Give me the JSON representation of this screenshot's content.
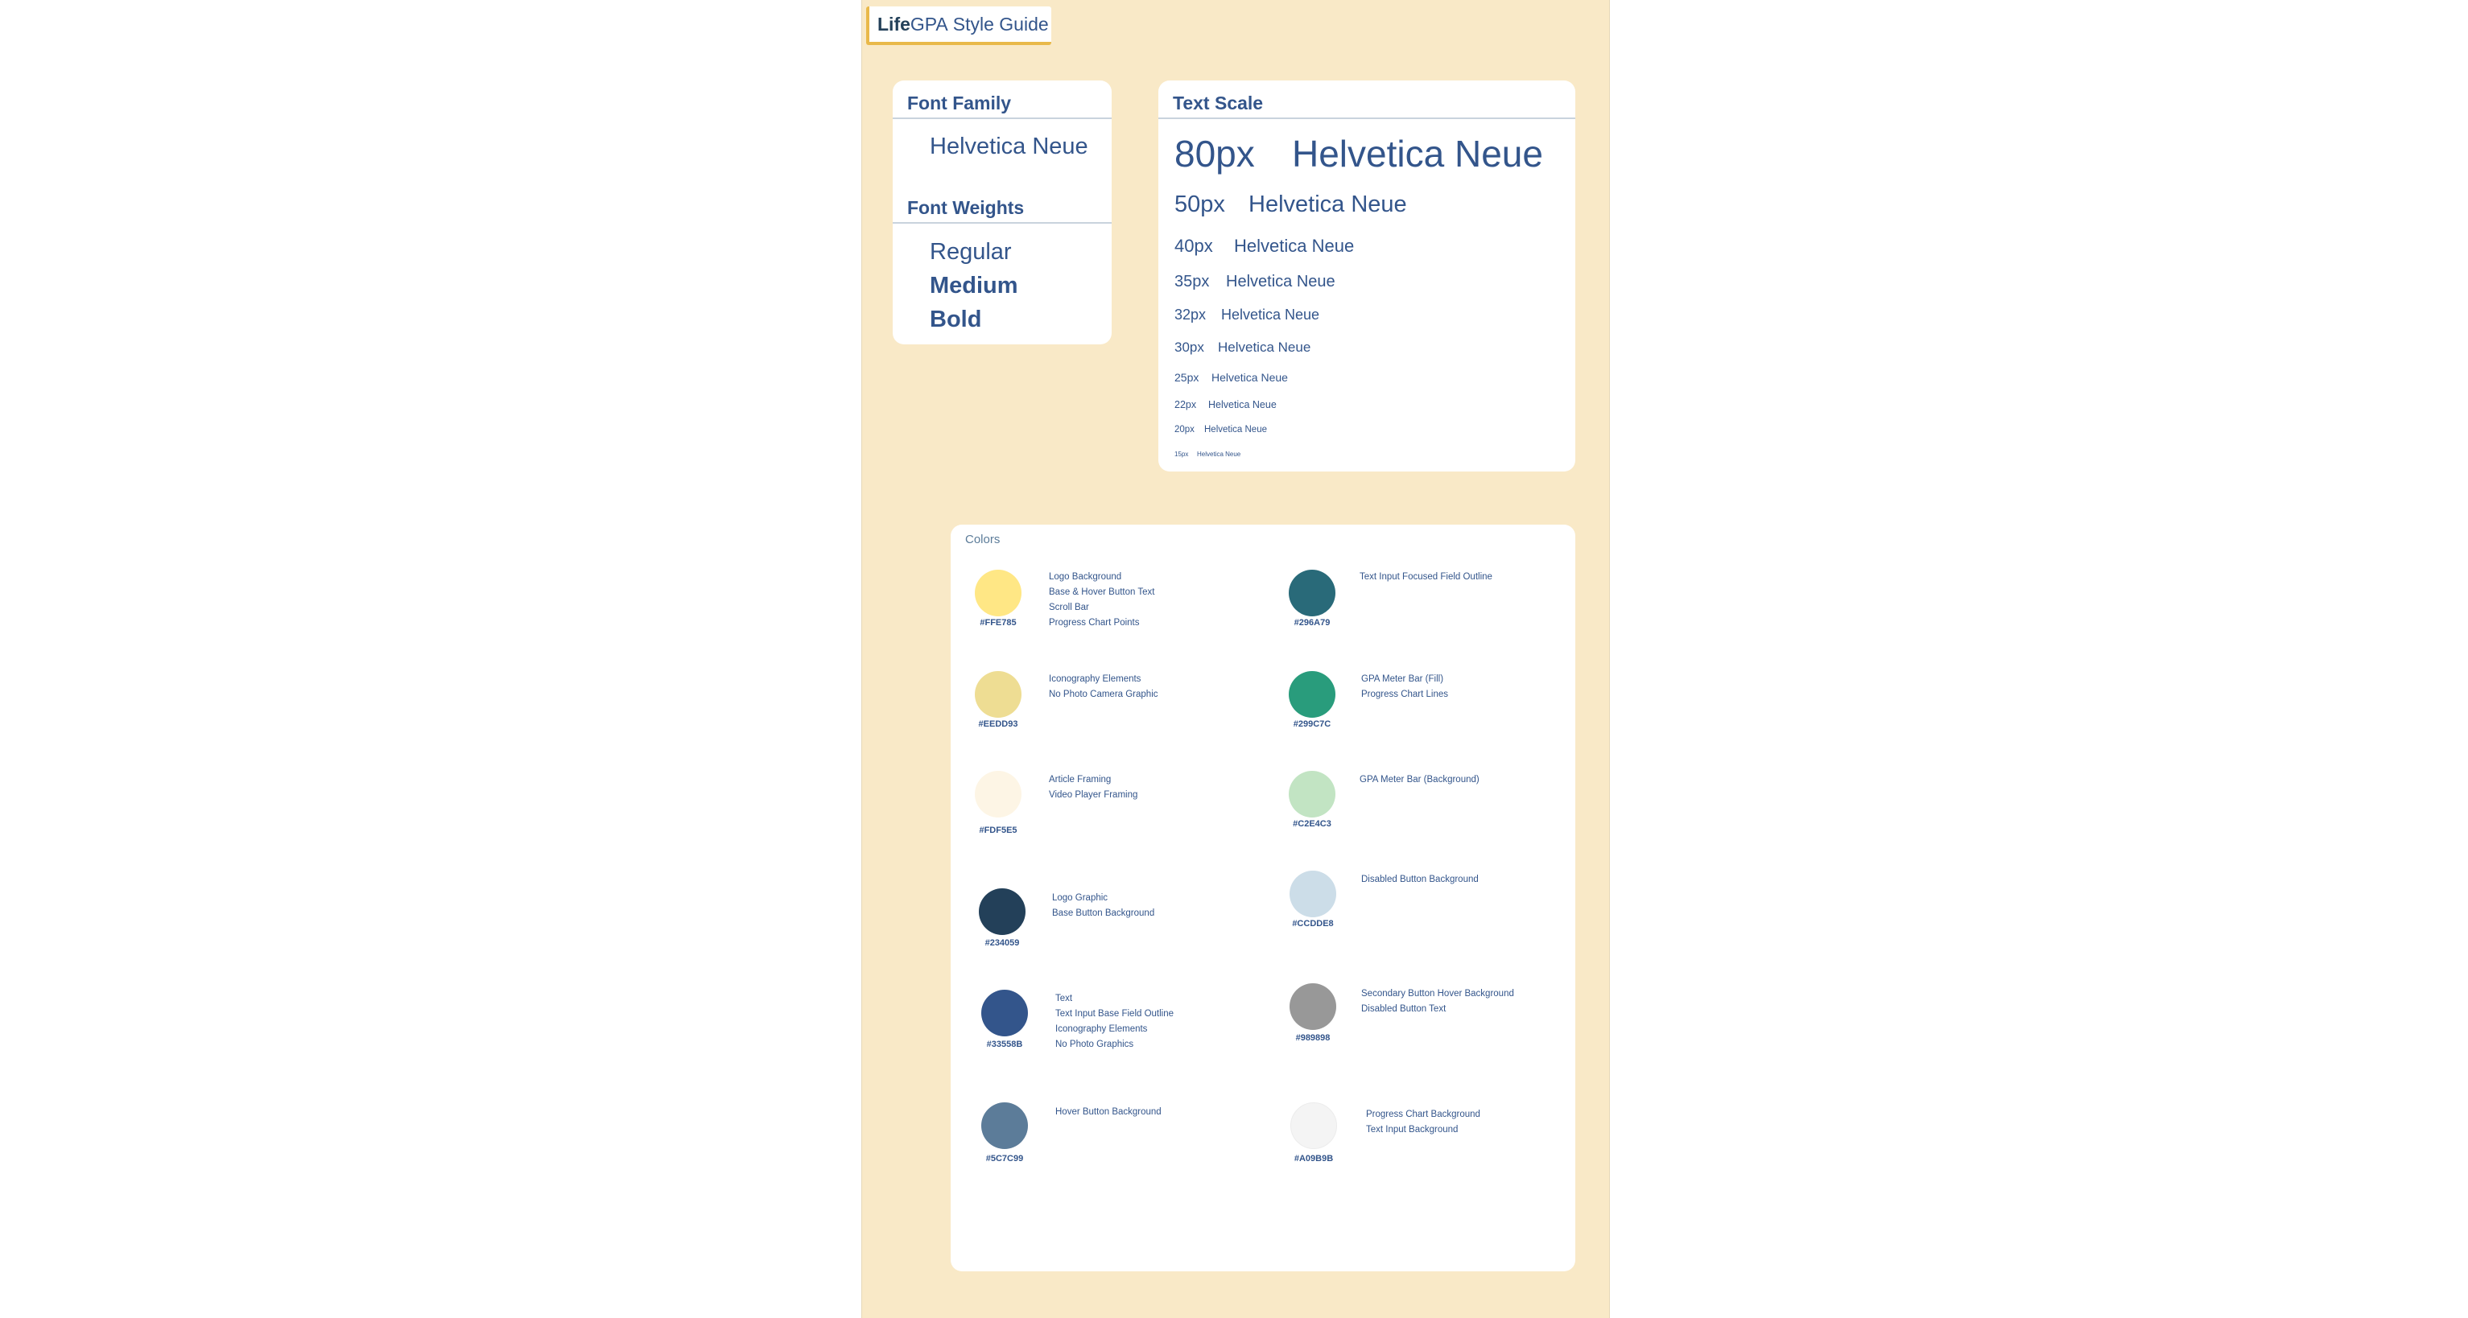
{
  "header": {
    "brand_bold": "Life",
    "brand_light": "GPA",
    "subtitle": "Style Guide"
  },
  "font_family": {
    "title": "Font Family",
    "value": "Helvetica Neue"
  },
  "font_weights": {
    "title": "Font Weights",
    "items": [
      "Regular",
      "Medium",
      "Bold"
    ]
  },
  "text_scale": {
    "title": "Text Scale",
    "rows": [
      {
        "size": "80px",
        "sample": "Helvetica Neue"
      },
      {
        "size": "50px",
        "sample": "Helvetica Neue"
      },
      {
        "size": "40px",
        "sample": "Helvetica Neue"
      },
      {
        "size": "35px",
        "sample": "Helvetica Neue"
      },
      {
        "size": "32px",
        "sample": "Helvetica Neue"
      },
      {
        "size": "30px",
        "sample": "Helvetica Neue"
      },
      {
        "size": "25px",
        "sample": "Helvetica Neue"
      },
      {
        "size": "22px",
        "sample": "Helvetica Neue"
      },
      {
        "size": "20px",
        "sample": "Helvetica Neue"
      },
      {
        "size": "15px",
        "sample": "Helvetica Neue"
      }
    ]
  },
  "colors": {
    "title": "Colors",
    "left": [
      {
        "hex": "#FFE785",
        "color": "#FFE785",
        "uses": [
          "Logo Background",
          "Base & Hover Button Text",
          "Scroll Bar",
          "Progress Chart Points"
        ]
      },
      {
        "hex": "#EEDD93",
        "color": "#EEDD93",
        "uses": [
          "Iconography Elements",
          "No Photo Camera Graphic"
        ]
      },
      {
        "hex": "#FDF5E5",
        "color": "#FDF5E5",
        "uses": [
          "Article Framing",
          "Video Player Framing"
        ]
      },
      {
        "hex": "#234059",
        "color": "#234059",
        "uses": [
          "Logo Graphic",
          "Base Button Background"
        ]
      },
      {
        "hex": "#33558B",
        "color": "#33558B",
        "uses": [
          "Text",
          "Text Input Base Field Outline",
          "Iconography Elements",
          "No Photo Graphics"
        ]
      },
      {
        "hex": "#5C7C99",
        "color": "#5C7C99",
        "uses": [
          "Hover Button Background"
        ]
      }
    ],
    "right": [
      {
        "hex": "#296A79",
        "color": "#296A79",
        "uses": [
          "Text Input Focused Field Outline"
        ]
      },
      {
        "hex": "#299C7C",
        "color": "#299C7C",
        "uses": [
          "GPA Meter Bar (Fill)",
          "Progress Chart Lines"
        ]
      },
      {
        "hex": "#C2E4C3",
        "color": "#C2E4C3",
        "uses": [
          "GPA Meter Bar (Background)"
        ]
      },
      {
        "hex": "#CCDDE8",
        "color": "#CCDDE8",
        "uses": [
          "Disabled Button Background"
        ]
      },
      {
        "hex": "#989898",
        "color": "#989898",
        "uses": [
          "Secondary Button Hover Background",
          "Disabled Button Text"
        ]
      },
      {
        "hex": "#A09B9B",
        "color": "#F4F4F4",
        "uses": [
          "Progress Chart Background",
          "Text Input Background"
        ]
      }
    ]
  }
}
